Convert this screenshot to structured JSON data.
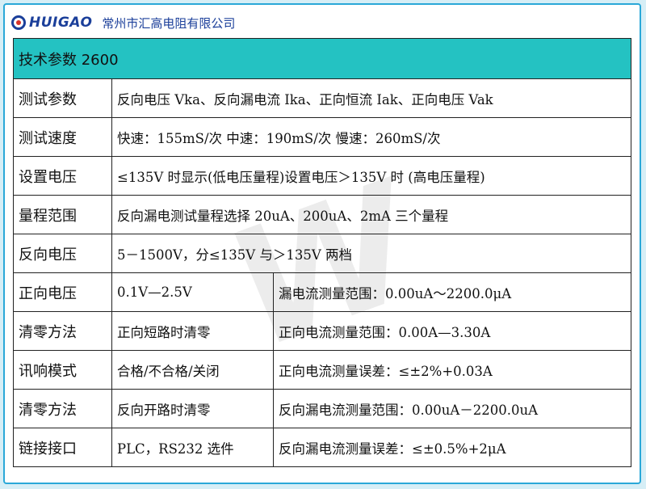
{
  "header": {
    "brand": "HUIGAO",
    "company": "常州市汇高电阻有限公司"
  },
  "title": "技术参数 2600",
  "rows": [
    {
      "label": "测试参数",
      "value": "反向电压 Vka、反向漏电流 Ika、正向恒流 Iak、正向电压 Vak"
    },
    {
      "label": "测试速度",
      "value": "快速：155mS/次 中速：190mS/次  慢速：260mS/次"
    },
    {
      "label": "设置电压",
      "value": "≤135V 时显示(低电压量程)设置电压＞135V 时 (高电压量程)"
    },
    {
      "label": "量程范围",
      "value": "反向漏电测试量程选择 20uA、200uA、2mA 三个量程"
    },
    {
      "label": "反向电压",
      "value": "5－1500V，分≤135V 与＞135V 两档"
    }
  ],
  "split_rows": [
    {
      "label": "正向电压",
      "left": "0.1V—2.5V",
      "right": "漏电流测量范围：0.00uA～2200.0μA"
    },
    {
      "label": "清零方法",
      "left": "正向短路时清零",
      "right": "正向电流测量范围：0.00A—3.30A"
    },
    {
      "label": "讯响模式",
      "left": "合格/不合格/关闭",
      "right": "正向电流测量误差：≤±2%+0.03A"
    },
    {
      "label": "清零方法",
      "left": "反向开路时清零",
      "right": "反向漏电流测量范围：0.00uA－2200.0uA"
    },
    {
      "label": "链接接口",
      "left": "PLC，RS232 选件",
      "right": "反向漏电流测量误差：≤±0.5%+2μA"
    }
  ],
  "colors": {
    "title_bg": "#24c2c2",
    "brand": "#1b3f9a",
    "frame": "#2aa8d8"
  }
}
